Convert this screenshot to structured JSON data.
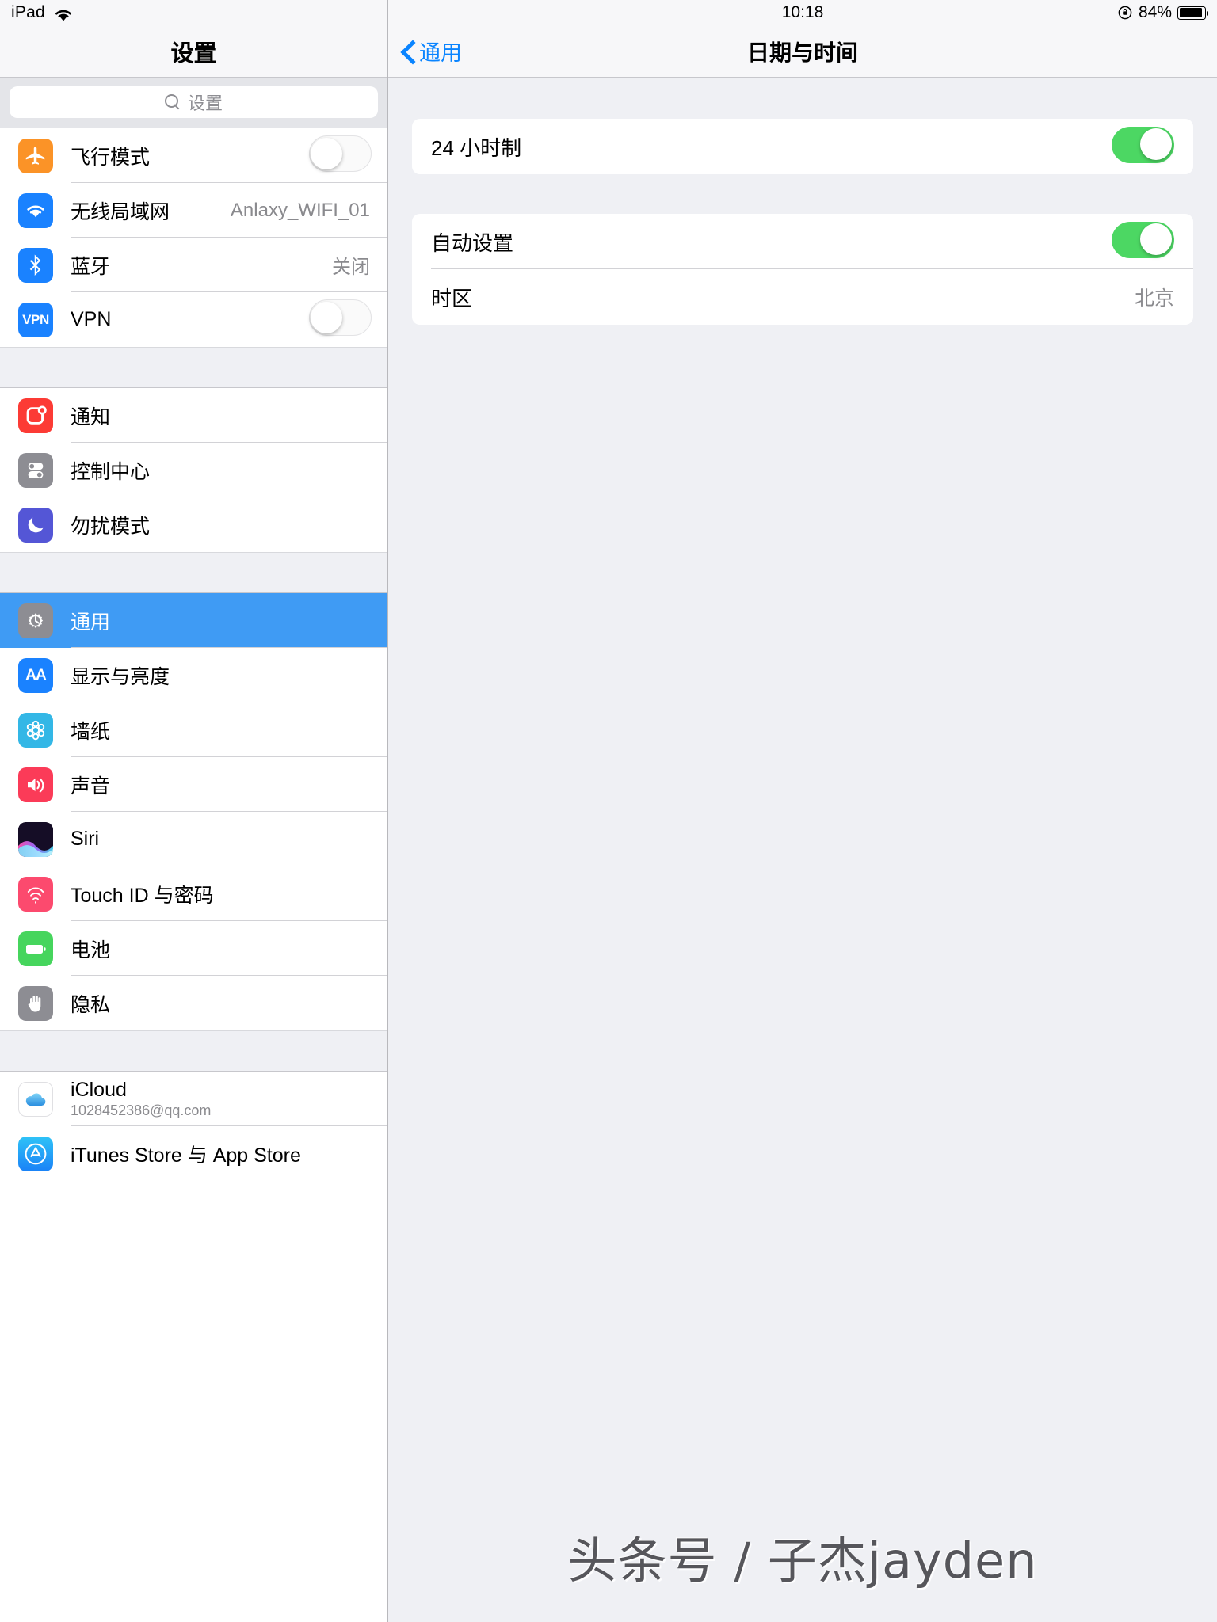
{
  "sidebar": {
    "status": {
      "carrier": "iPad",
      "wifi_icon": "wifi-icon"
    },
    "nav_title": "设置",
    "search": {
      "placeholder": "设置",
      "icon": "search-icon"
    },
    "groups": [
      {
        "rows": [
          {
            "label": "飞行模式",
            "icon": "airplane-icon",
            "control": "toggle",
            "toggle_on": false
          },
          {
            "label": "无线局域网",
            "icon": "wifi-icon",
            "control": "value",
            "value": "Anlaxy_WIFI_01"
          },
          {
            "label": "蓝牙",
            "icon": "bluetooth-icon",
            "control": "value",
            "value": "关闭"
          },
          {
            "label": "VPN",
            "icon": "vpn-icon",
            "control": "toggle",
            "toggle_on": false
          }
        ]
      },
      {
        "rows": [
          {
            "label": "通知",
            "icon": "notifications-icon",
            "control": "none"
          },
          {
            "label": "控制中心",
            "icon": "control-center-icon",
            "control": "none"
          },
          {
            "label": "勿扰模式",
            "icon": "do-not-disturb-icon",
            "control": "none"
          }
        ]
      },
      {
        "rows": [
          {
            "label": "通用",
            "icon": "gear-icon",
            "control": "none",
            "selected": true
          },
          {
            "label": "显示与亮度",
            "icon": "display-brightness-icon",
            "control": "none"
          },
          {
            "label": "墙纸",
            "icon": "wallpaper-icon",
            "control": "none"
          },
          {
            "label": "声音",
            "icon": "sound-icon",
            "control": "none"
          },
          {
            "label": "Siri",
            "icon": "siri-icon",
            "control": "none"
          },
          {
            "label": "Touch ID 与密码",
            "icon": "touch-id-icon",
            "control": "none"
          },
          {
            "label": "电池",
            "icon": "battery-icon",
            "control": "none"
          },
          {
            "label": "隐私",
            "icon": "privacy-icon",
            "control": "none"
          }
        ]
      },
      {
        "rows": [
          {
            "label": "iCloud",
            "sublabel": "1028452386@qq.com",
            "icon": "icloud-icon",
            "control": "none"
          },
          {
            "label": "iTunes Store 与 App Store",
            "icon": "app-store-icon",
            "control": "none"
          }
        ]
      }
    ]
  },
  "detail": {
    "status": {
      "clock": "10:18",
      "battery_percent": "84%",
      "rotation_lock_icon": "rotation-lock-icon",
      "battery_icon": "battery-icon"
    },
    "back_label": "通用",
    "back_icon": "chevron-left-icon",
    "title": "日期与时间",
    "sections": [
      {
        "rows": [
          {
            "label": "24 小时制",
            "control": "toggle",
            "toggle_on": true
          }
        ]
      },
      {
        "rows": [
          {
            "label": "自动设置",
            "control": "toggle",
            "toggle_on": true
          },
          {
            "label": "时区",
            "control": "value",
            "value": "北京"
          }
        ]
      }
    ]
  },
  "watermark": "头条号 / 子杰jayden",
  "colors": {
    "accent_blue": "#0a84ff",
    "selection_blue": "#3f9bf4",
    "toggle_green": "#4cd763",
    "panel_bg": "#eff0f4"
  }
}
